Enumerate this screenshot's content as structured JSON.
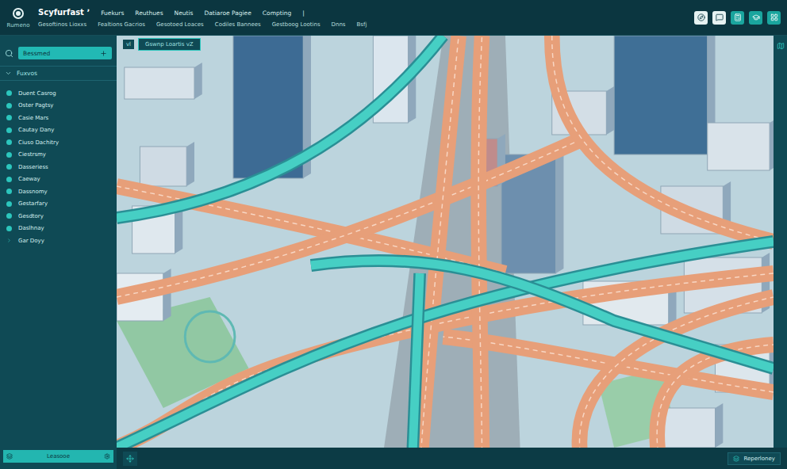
{
  "app": {
    "name": "Scyfurfast",
    "mark": "ʼ",
    "logo_label": "Rumeno"
  },
  "menu": [
    "Fuekurs",
    "Reuthues",
    "Neutis",
    "Datiaroe Pagiee",
    "Compting",
    "|"
  ],
  "submenu": [
    "Gesoftinos Lioxxs",
    "Fealtions Gacrios",
    "Gesotoed Loaces",
    "Codiles Bannees",
    "Gestboog Lootins",
    "Dnns",
    "Bsfj"
  ],
  "search": {
    "value": "Bessmed"
  },
  "sidebar": {
    "section": "Fuxvos",
    "expanded": true,
    "items": [
      {
        "label": "Duent Casrog",
        "kind": "dot"
      },
      {
        "label": "Oster Pagtsy",
        "kind": "dot"
      },
      {
        "label": "Casie Mars",
        "kind": "dot"
      },
      {
        "label": "Cautay Dany",
        "kind": "dot"
      },
      {
        "label": "Ciuso Dachitry",
        "kind": "dot"
      },
      {
        "label": "Ciestrsmy",
        "kind": "dot"
      },
      {
        "label": "Dasseriess",
        "kind": "dot"
      },
      {
        "label": "Caeway",
        "kind": "dot"
      },
      {
        "label": "Dassnomy",
        "kind": "dot"
      },
      {
        "label": "Gestarfary",
        "kind": "dot"
      },
      {
        "label": "Gesdtory",
        "kind": "dot"
      },
      {
        "label": "Daslhnay",
        "kind": "dot"
      },
      {
        "label": "Gar Doyy",
        "kind": "group"
      }
    ]
  },
  "map": {
    "layer_badge": "vl",
    "tab_label": "Gswnp Loartis vZ"
  },
  "footer": {
    "button": "Leasooe",
    "status": "Reperloney"
  }
}
